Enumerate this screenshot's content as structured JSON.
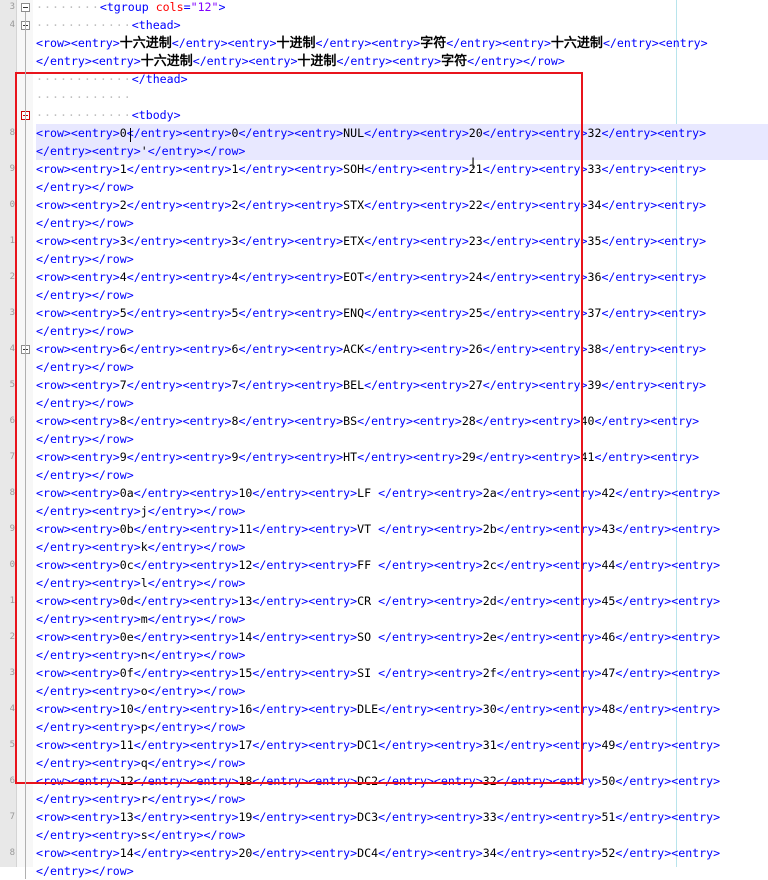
{
  "editor": {
    "line_numbers": [
      "3",
      "4",
      "",
      "",
      "",
      "",
      "",
      "8",
      "",
      "9",
      "",
      "0",
      "",
      "1",
      "",
      "2",
      "",
      "3",
      "",
      "4",
      "",
      "5",
      "",
      "6",
      "",
      "7",
      "",
      "8",
      "",
      "9",
      "",
      "0",
      "",
      "1",
      "",
      "2",
      "",
      "3",
      "",
      "4",
      "",
      "5",
      "",
      "6",
      "",
      "7",
      "",
      "8"
    ],
    "lines": {
      "tgroup_open": "<tgroup",
      "tgroup_attr": "cols",
      "tgroup_val": "\"12\"",
      "thead_open": "<thead>",
      "thead_close": "</thead>",
      "tbody_open": "<tbody>"
    },
    "header_row": {
      "line1_parts": [
        "十六进制",
        "十进制",
        "字符",
        "十六进制"
      ],
      "line2_parts": [
        "十六进制",
        "十进制",
        "字符"
      ]
    },
    "rows": [
      {
        "hex": "0",
        "dec": "0",
        "chr": "NUL",
        "hex2": "20",
        "dec2": "32",
        "tail": "'"
      },
      {
        "hex": "1",
        "dec": "1",
        "chr": "SOH",
        "hex2": "21",
        "dec2": "33",
        "tail": ""
      },
      {
        "hex": "2",
        "dec": "2",
        "chr": "STX",
        "hex2": "22",
        "dec2": "34",
        "tail": ""
      },
      {
        "hex": "3",
        "dec": "3",
        "chr": "ETX",
        "hex2": "23",
        "dec2": "35",
        "tail": ""
      },
      {
        "hex": "4",
        "dec": "4",
        "chr": "EOT",
        "hex2": "24",
        "dec2": "36",
        "tail": ""
      },
      {
        "hex": "5",
        "dec": "5",
        "chr": "ENQ",
        "hex2": "25",
        "dec2": "37",
        "tail": ""
      },
      {
        "hex": "6",
        "dec": "6",
        "chr": "ACK",
        "hex2": "26",
        "dec2": "38",
        "tail": ""
      },
      {
        "hex": "7",
        "dec": "7",
        "chr": "BEL",
        "hex2": "27",
        "dec2": "39",
        "tail": ""
      },
      {
        "hex": "8",
        "dec": "8",
        "chr": "BS",
        "hex2": "28",
        "dec2": "40",
        "tail": ""
      },
      {
        "hex": "9",
        "dec": "9",
        "chr": "HT",
        "hex2": "29",
        "dec2": "41",
        "tail": ""
      },
      {
        "hex": "0a",
        "dec": "10",
        "chr": "LF ",
        "hex2": "2a",
        "dec2": "42",
        "tail": "j"
      },
      {
        "hex": "0b",
        "dec": "11",
        "chr": "VT ",
        "hex2": "2b",
        "dec2": "43",
        "tail": "k"
      },
      {
        "hex": "0c",
        "dec": "12",
        "chr": "FF ",
        "hex2": "2c",
        "dec2": "44",
        "tail": "l"
      },
      {
        "hex": "0d",
        "dec": "13",
        "chr": "CR ",
        "hex2": "2d",
        "dec2": "45",
        "tail": "m"
      },
      {
        "hex": "0e",
        "dec": "14",
        "chr": "SO ",
        "hex2": "2e",
        "dec2": "46",
        "tail": "n"
      },
      {
        "hex": "0f",
        "dec": "15",
        "chr": "SI ",
        "hex2": "2f",
        "dec2": "47",
        "tail": "o"
      },
      {
        "hex": "10",
        "dec": "16",
        "chr": "DLE",
        "hex2": "30",
        "dec2": "48",
        "tail": "p"
      },
      {
        "hex": "11",
        "dec": "17",
        "chr": "DC1",
        "hex2": "31",
        "dec2": "49",
        "tail": "q"
      },
      {
        "hex": "12",
        "dec": "18",
        "chr": "DC2",
        "hex2": "32",
        "dec2": "50",
        "tail": "r"
      },
      {
        "hex": "13",
        "dec": "19",
        "chr": "DC3",
        "hex2": "33",
        "dec2": "51",
        "tail": "s"
      },
      {
        "hex": "14",
        "dec": "20",
        "chr": "DC4",
        "hex2": "34",
        "dec2": "52",
        "tail": ""
      }
    ]
  },
  "colors": {
    "tag": "#0000ff",
    "attribute": "#ff0000",
    "attribute_value": "#8000ff",
    "highlight_line": "#e8e8ff",
    "annotation_box": "#e8141c"
  }
}
